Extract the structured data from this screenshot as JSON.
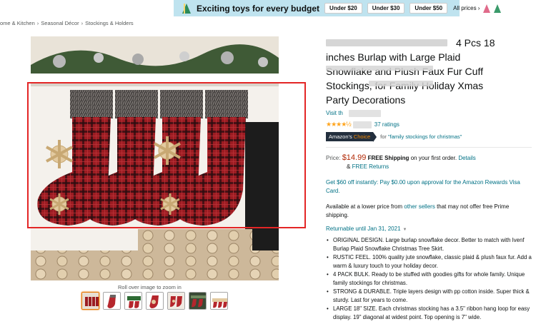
{
  "banner": {
    "headline": "Exciting toys for every budget",
    "pills": [
      "Under $20",
      "Under $30",
      "Under $50"
    ],
    "all_prices": "All prices ›"
  },
  "breadcrumb": [
    "ome & Kitchen",
    "Seasonal Décor",
    "Stockings & Holders"
  ],
  "gallery": {
    "zoom_hint": "Roll over image to zoom in",
    "thumbnail_count": 7
  },
  "product": {
    "title_fragment": "4 Pcs 18",
    "title_lines": [
      "inches Burlap with Large Plaid",
      "Snowflake and Plush Faux Fur Cuff",
      "Stockings, for Family Holiday Xmas",
      "Party Decorations"
    ],
    "store_prefix": "Visit th",
    "rating_stars": 4.5,
    "ratings_count": "37 ratings",
    "choice_badge_prefix": "Amazon's",
    "choice_badge_word": "Choice",
    "choice_for_label": "for",
    "choice_query": "\"family stockings for christmas\""
  },
  "pricing": {
    "label": "Price:",
    "price": "$14.99",
    "shipping": "FREE Shipping",
    "shipping_rest": "on your first order.",
    "details_link": "Details",
    "returns_prefix": "&",
    "returns_link": "FREE Returns"
  },
  "offer": "Get $60 off instantly: Pay $0.00 upon approval for the Amazon Rewards Visa Card.",
  "availability": {
    "prefix": "Available at a lower price from",
    "link": "other sellers",
    "suffix": "that may not offer free Prime shipping."
  },
  "returnable": "Returnable until Jan 31, 2021",
  "bullets": [
    "ORIGINAL DESIGN. Large burlap snowflake decor. Better to match with Ivenf Burlap Plaid Snowflake Christmas Tree Skirt.",
    "RUSTIC FEEL. 100% quality jute snowflake, classic plaid & plush faux fur. Add a warm & luxury touch to your holiday decor.",
    "4 PACK BULK. Ready to be stuffed with goodies gifts for whole family. Unique family stockings for christmas.",
    "STRONG & DURABLE. Triple layers design with pp cotton inside. Super thick & sturdy. Last for years to come.",
    "LARGE 18\" SIZE. Each christmas stocking has a 3.5\" ribbon hang loop for easy display. 19\" diagonal at widest point. Top opening is 7\" wide."
  ],
  "colors": {
    "link": "#007185",
    "price": "#b12704",
    "star": "#ffa41c",
    "badge": "#232f3e",
    "highlight": "#e32626",
    "banner": "#bfe3ef"
  }
}
